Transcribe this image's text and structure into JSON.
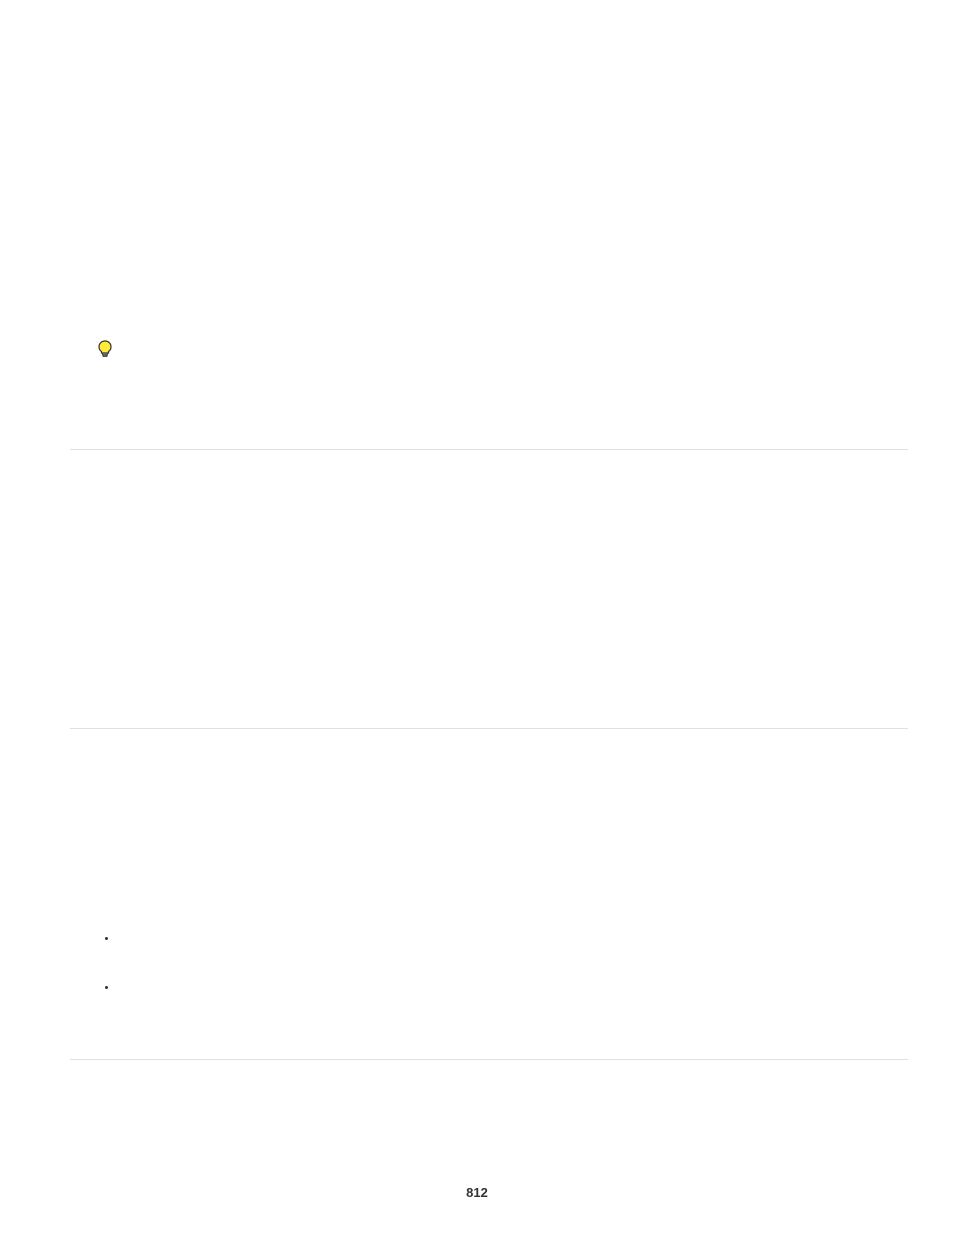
{
  "page_number": "812"
}
